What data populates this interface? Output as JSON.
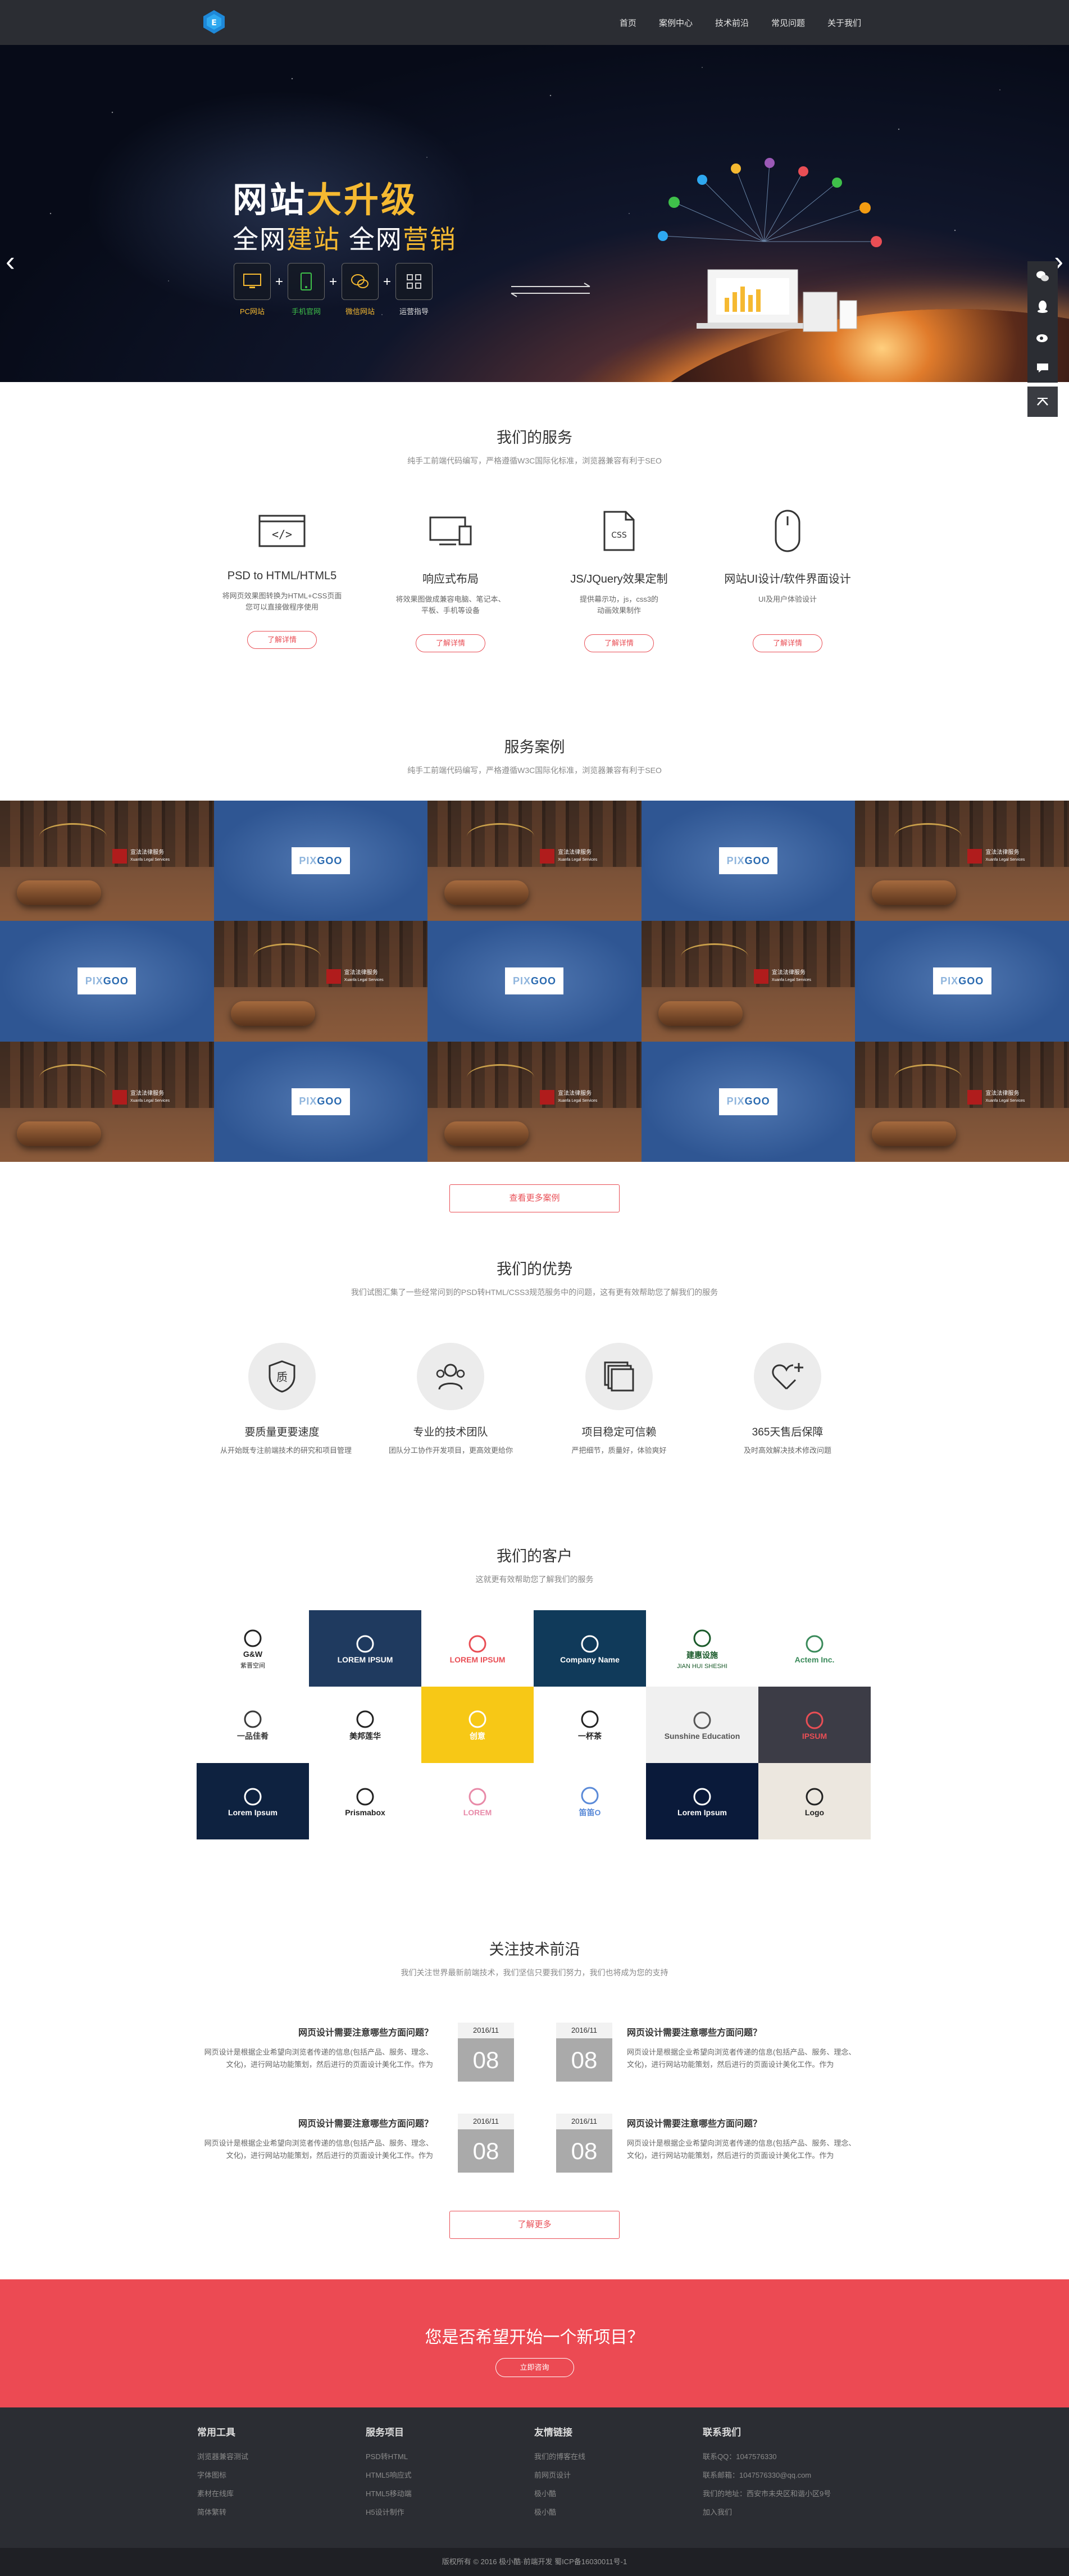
{
  "nav": {
    "items": [
      "首页",
      "案例中心",
      "技术前沿",
      "常见问题",
      "关于我们"
    ]
  },
  "banner": {
    "title_plain": "网站",
    "title_highlight": "大升级",
    "subtitle_part1": "全网",
    "subtitle_hl1": "建站",
    "subtitle_part2": " 全网",
    "subtitle_hl2": "营销",
    "features": [
      "PC网站",
      "手机官网",
      "微信网站",
      "运营指导"
    ]
  },
  "sidebar": {
    "icons": [
      "wechat-icon",
      "qq-icon",
      "weibo-icon",
      "message-icon"
    ],
    "top_icon": "arrow-up-icon"
  },
  "services": {
    "title": "我们的服务",
    "subtitle": "纯手工前端代码编写，严格遵循W3C国际化标准，浏览器兼容有利于SEO",
    "items": [
      {
        "name": "PSD to HTML/HTML5",
        "desc1": "将网页效果图转换为HTML+CSS页面",
        "desc2": "您可以直接做程序使用",
        "button": "了解详情"
      },
      {
        "name": "响应式布局",
        "desc1": "将效果图做成兼容电脑、笔记本、",
        "desc2": "平板、手机等设备",
        "button": "了解详情"
      },
      {
        "name": "JS/JQuery效果定制",
        "desc1": "提供幕示功，js，css3的",
        "desc2": "动画效果制作",
        "button": "了解详情"
      },
      {
        "name": "网站UI设计/软件界面设计",
        "desc1": "UI及用户体验设计",
        "desc2": "",
        "button": "了解详情"
      }
    ]
  },
  "cases": {
    "title": "服务案例",
    "subtitle": "纯手工前端代码编写，严格遵循W3C国际化标准，浏览器兼容有利于SEO",
    "law_name": "宣法法律服务",
    "law_sub": "Xuanfa Legal Services",
    "pix_logo_a": "PIX",
    "pix_logo_b": "GOO",
    "more": "查看更多案例"
  },
  "advantages": {
    "title": "我们的优势",
    "subtitle": "我们试图汇集了一些经常问到的PSD转HTML/CSS3规范服务中的问题，这有更有效帮助您了解我们的服务",
    "items": [
      {
        "name": "要质量更要速度",
        "desc": "从开始既专注前端技术的研究和项目管理"
      },
      {
        "name": "专业的技术团队",
        "desc": "团队分工协作开发项目，更高效更给你"
      },
      {
        "name": "项目稳定可信赖",
        "desc": "严把细节，质量好，体验爽好"
      },
      {
        "name": "365天售后保障",
        "desc": "及时高效解决技术修改问题"
      }
    ]
  },
  "clients": {
    "title": "我们的客户",
    "subtitle": "这就更有效帮助您了解我们的服务",
    "logos": [
      {
        "name": "G&W",
        "sub": "紫晋空间"
      },
      {
        "name": "LOREM IPSUM",
        "sub": ""
      },
      {
        "name": "LOREM IPSUM",
        "sub": ""
      },
      {
        "name": "Company Name",
        "sub": ""
      },
      {
        "name": "建惠设施",
        "sub": "JIAN HUI SHESHI"
      },
      {
        "name": "Actem Inc.",
        "sub": ""
      },
      {
        "name": "一品佳肴",
        "sub": ""
      },
      {
        "name": "美邦莲华",
        "sub": ""
      },
      {
        "name": "创意",
        "sub": ""
      },
      {
        "name": "一杯茶",
        "sub": ""
      },
      {
        "name": "Sunshine Education",
        "sub": ""
      },
      {
        "name": "IPSUM",
        "sub": ""
      },
      {
        "name": "Lorem Ipsum",
        "sub": ""
      },
      {
        "name": "Prismabox",
        "sub": ""
      },
      {
        "name": "LOREM",
        "sub": ""
      },
      {
        "name": "笛笛O",
        "sub": ""
      },
      {
        "name": "Lorem Ipsum",
        "sub": ""
      },
      {
        "name": "Logo",
        "sub": ""
      }
    ]
  },
  "news": {
    "title": "关注技术前沿",
    "subtitle": "我们关注世界最新前端技术，我们坚信只要我们努力，我们也将成为您的支持",
    "items": [
      {
        "title": "网页设计需要注意哪些方面问题？",
        "text1": "网页设计是根据企业希望向浏览者传递的信息(包括产品、服务、理念、",
        "text2": "文化)，进行网站功能策划，然后进行的页面设计美化工作。作为",
        "date": "2016/11",
        "day": "08"
      },
      {
        "title": "网页设计需要注意哪些方面问题？",
        "text1": "网页设计是根据企业希望向浏览者传递的信息(包括产品、服务、理念、",
        "text2": "文化)，进行网站功能策划，然后进行的页面设计美化工作。作为",
        "date": "2016/11",
        "day": "08"
      },
      {
        "title": "网页设计需要注意哪些方面问题？",
        "text1": "网页设计是根据企业希望向浏览者传递的信息(包括产品、服务、理念、",
        "text2": "文化)，进行网站功能策划，然后进行的页面设计美化工作。作为",
        "date": "2016/11",
        "day": "08"
      },
      {
        "title": "网页设计需要注意哪些方面问题？",
        "text1": "网页设计是根据企业希望向浏览者传递的信息(包括产品、服务、理念、",
        "text2": "文化)，进行网站功能策划，然后进行的页面设计美化工作。作为",
        "date": "2016/11",
        "day": "08"
      }
    ],
    "more": "了解更多"
  },
  "cta": {
    "title": "您是否希望开始一个新项目？",
    "button": "立即咨询"
  },
  "footer": {
    "columns": [
      {
        "title": "常用工具",
        "links": [
          "浏览器兼容测试",
          "字体图标",
          "素材在线库",
          "简体繁转"
        ]
      },
      {
        "title": "服务项目",
        "links": [
          "PSD转HTML",
          "HTML5响应式",
          "HTML5移动端",
          "H5设计制作"
        ]
      },
      {
        "title": "友情链接",
        "links": [
          "我们的博客在线",
          "前网页设计",
          "极小酷",
          "极小酷"
        ]
      },
      {
        "title": "联系我们",
        "links": [
          "联系QQ：1047576330",
          "联系邮箱：1047576330@qq.com",
          "我们的地址：西安市未央区和谐小区9号",
          "加入我们"
        ]
      }
    ],
    "copyright": "版权所有 © 2016 极小酷·前端开发 蜀ICP备16030011号-1"
  },
  "colors": {
    "accent": "#e94e55",
    "header": "#2b2d33",
    "highlight": "#f5b931"
  }
}
